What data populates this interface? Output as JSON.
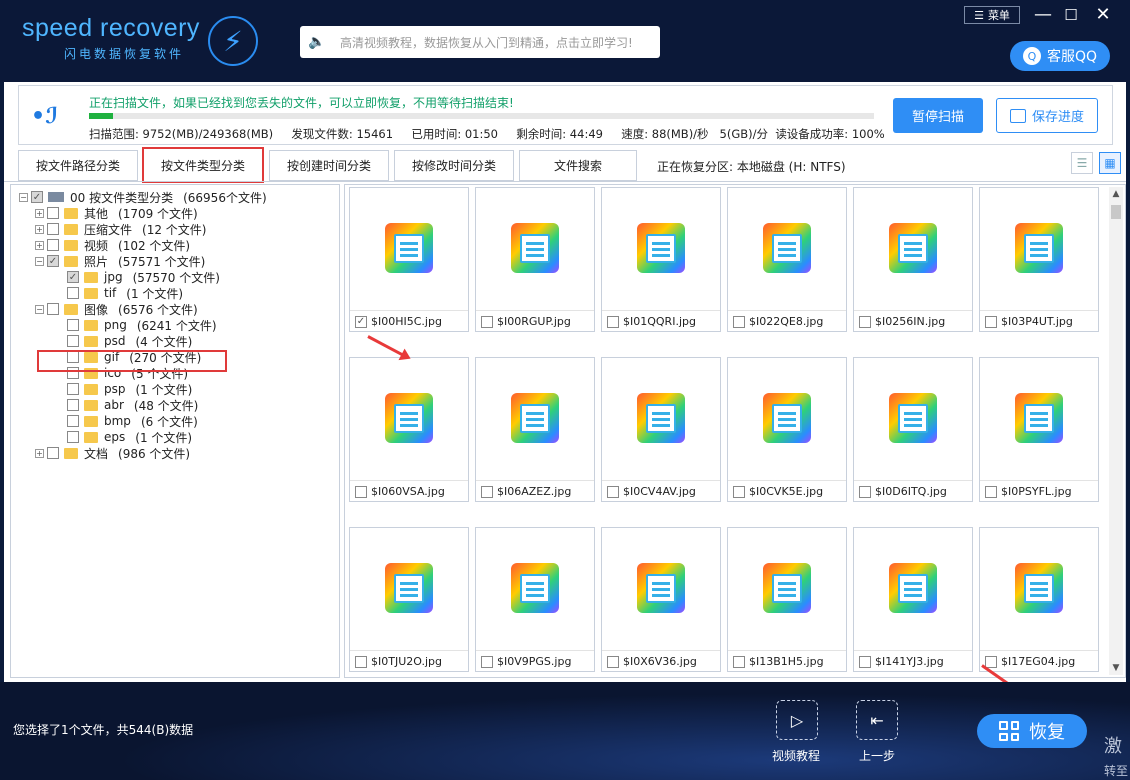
{
  "header": {
    "logo_name": "speed recovery",
    "logo_sub": "闪电数据恢复软件",
    "search_text": "高清视频教程，数据恢复从入门到精通，点击立即学习!",
    "menu_label": "菜单",
    "qq_label": "客服QQ"
  },
  "scan": {
    "message": "正在扫描文件，如果已经找到您丢失的文件，可以立即恢复，不用等待扫描结束!",
    "progress_percent": 3,
    "range": "扫描范围: 9752(MB)/249368(MB)",
    "found": "发现文件数: 15461",
    "elapsed": "已用时间: 01:50",
    "remaining": "剩余时间: 44:49",
    "speed": "速度: 88(MB)/秒",
    "speed2": "5(GB)/分",
    "success_rate": "读设备成功率: 100%",
    "pause_label": "暂停扫描",
    "save_label": "保存进度"
  },
  "tabs": [
    "按文件路径分类",
    "按文件类型分类",
    "按创建时间分类",
    "按修改时间分类",
    "文件搜索"
  ],
  "active_tab": 1,
  "partition_info": "正在恢复分区: 本地磁盘 (H: NTFS)",
  "tree": {
    "root_label": "00  按文件类型分类",
    "root_count": "(66956个文件)",
    "items": [
      {
        "label": "其他",
        "count": "(1709 个文件)"
      },
      {
        "label": "压缩文件",
        "count": "(12 个文件)"
      },
      {
        "label": "视频",
        "count": "(102 个文件)"
      },
      {
        "label": "照片",
        "count": "(57571 个文件)"
      },
      {
        "label": "jpg",
        "count": "(57570 个文件)"
      },
      {
        "label": "tif",
        "count": "(1 个文件)"
      },
      {
        "label": "图像",
        "count": "(6576 个文件)"
      },
      {
        "label": "png",
        "count": "(6241 个文件)"
      },
      {
        "label": "psd",
        "count": "(4 个文件)"
      },
      {
        "label": "gif",
        "count": "(270 个文件)"
      },
      {
        "label": "ico",
        "count": "(5 个文件)"
      },
      {
        "label": "psp",
        "count": "(1 个文件)"
      },
      {
        "label": "abr",
        "count": "(48 个文件)"
      },
      {
        "label": "bmp",
        "count": "(6 个文件)"
      },
      {
        "label": "eps",
        "count": "(1 个文件)"
      },
      {
        "label": "文档",
        "count": "(986 个文件)"
      }
    ]
  },
  "files": [
    {
      "name": "$I00HI5C.jpg",
      "checked": true
    },
    {
      "name": "$I00RGUP.jpg",
      "checked": false
    },
    {
      "name": "$I01QQRI.jpg",
      "checked": false
    },
    {
      "name": "$I022QE8.jpg",
      "checked": false
    },
    {
      "name": "$I0256IN.jpg",
      "checked": false
    },
    {
      "name": "$I03P4UT.jpg",
      "checked": false
    },
    {
      "name": "$I060VSA.jpg",
      "checked": false
    },
    {
      "name": "$I06AZEZ.jpg",
      "checked": false
    },
    {
      "name": "$I0CV4AV.jpg",
      "checked": false
    },
    {
      "name": "$I0CVK5E.jpg",
      "checked": false
    },
    {
      "name": "$I0D6ITQ.jpg",
      "checked": false
    },
    {
      "name": "$I0PSYFL.jpg",
      "checked": false
    },
    {
      "name": "$I0TJU2O.jpg",
      "checked": false
    },
    {
      "name": "$I0V9PGS.jpg",
      "checked": false
    },
    {
      "name": "$I0X6V36.jpg",
      "checked": false
    },
    {
      "name": "$I13B1H5.jpg",
      "checked": false
    },
    {
      "name": "$I141YJ3.jpg",
      "checked": false
    },
    {
      "name": "$I17EG04.jpg",
      "checked": false
    }
  ],
  "footer": {
    "status": "您选择了1个文件，共544(B)数据",
    "video_label": "视频教程",
    "back_label": "上一步",
    "recover_label": "恢复",
    "watermark": "激",
    "watermark2": "转至"
  }
}
